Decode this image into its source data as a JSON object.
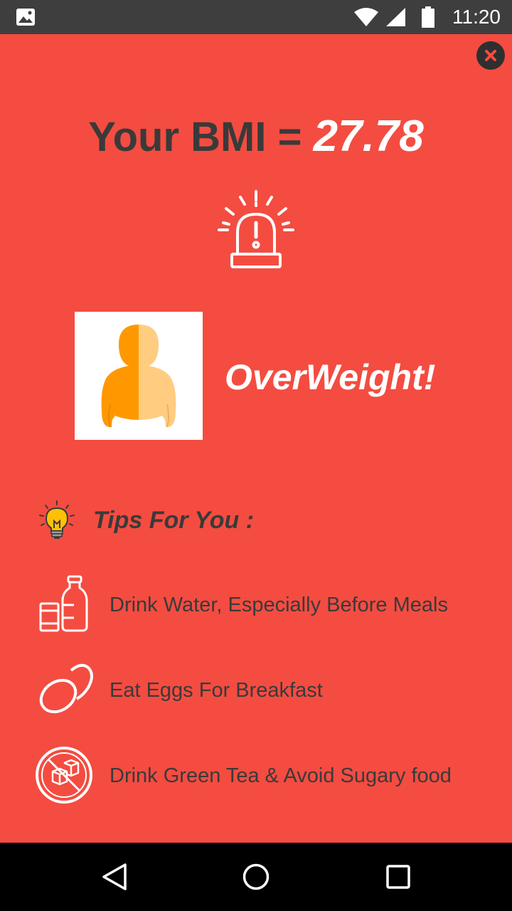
{
  "status_bar": {
    "time": "11:20",
    "icons": [
      "gallery-icon",
      "wifi-icon",
      "signal-icon",
      "battery-icon"
    ]
  },
  "result": {
    "bmi_label": "Your BMI = ",
    "bmi_value": "27.78",
    "status": "OverWeight!"
  },
  "tips": {
    "heading": "Tips For You :",
    "items": [
      {
        "icon": "water-bottle-icon",
        "text": "Drink Water, Especially Before Meals"
      },
      {
        "icon": "eggs-icon",
        "text": "Eat Eggs For Breakfast"
      },
      {
        "icon": "no-sugar-icon",
        "text": "Drink Green Tea & Avoid Sugary food"
      }
    ]
  },
  "nav": [
    "back-icon",
    "home-icon",
    "recents-icon"
  ],
  "colors": {
    "background": "#f44c41",
    "status_bar": "#3e3e3e",
    "heading_dark": "#3a3a3a",
    "figure_orange": "#ff9800",
    "figure_light": "#ffcc80"
  }
}
